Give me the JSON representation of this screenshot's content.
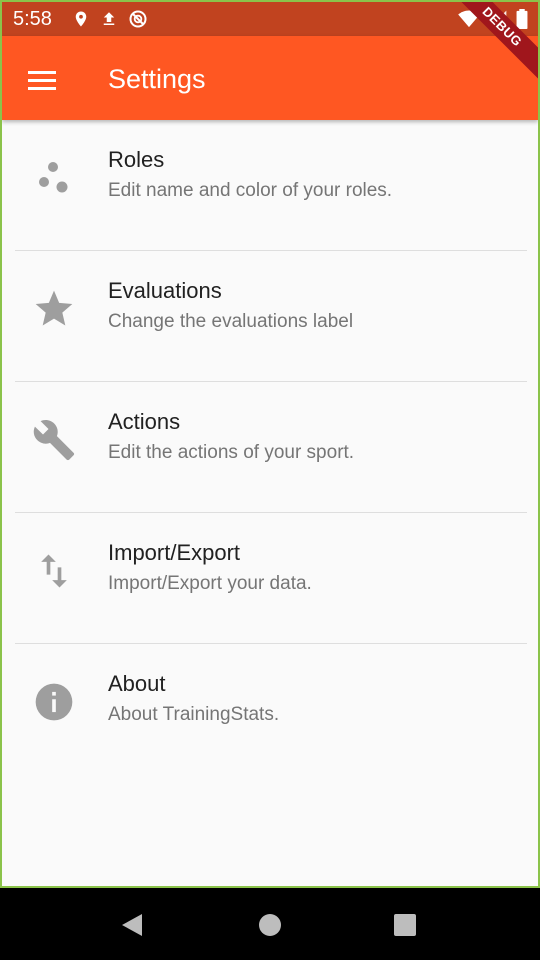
{
  "status_bar": {
    "time": "5:58",
    "left_icons": [
      "location-icon",
      "upload-icon",
      "no-sync-icon"
    ],
    "right_icons": [
      "wifi-icon",
      "signal-icon",
      "battery-icon"
    ]
  },
  "app_bar": {
    "title": "Settings",
    "menu_icon": "menu-icon",
    "color": "#ff5722"
  },
  "debug_banner": "DEBUG",
  "settings_items": [
    {
      "title": "Roles",
      "subtitle": "Edit name and color of your roles.",
      "icon": "bubble-chart-icon"
    },
    {
      "title": "Evaluations",
      "subtitle": "Change the evaluations label",
      "icon": "star-icon"
    },
    {
      "title": "Actions",
      "subtitle": "Edit the actions of your sport.",
      "icon": "wrench-icon"
    },
    {
      "title": "Import/Export",
      "subtitle": "Import/Export your data.",
      "icon": "import-export-icon"
    },
    {
      "title": "About",
      "subtitle": "About TrainingStats.",
      "icon": "info-icon"
    }
  ],
  "nav_bar": [
    "back-icon",
    "home-icon",
    "recents-icon"
  ]
}
